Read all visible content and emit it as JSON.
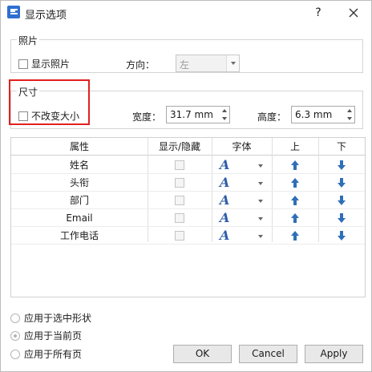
{
  "window": {
    "title": "显示选项",
    "help": "?"
  },
  "photo_group": {
    "label": "照片",
    "show_photo_label": "显示照片",
    "direction_label": "方向：",
    "direction_value": "左"
  },
  "size_group": {
    "label": "尺寸",
    "keep_size_label": "不改变大小",
    "width_label": "宽度：",
    "width_value": "31.7 mm",
    "height_label": "高度：",
    "height_value": "6.3 mm"
  },
  "table": {
    "headers": [
      "属性",
      "显示/隐藏",
      "字体",
      "上",
      "下"
    ],
    "rows": [
      {
        "property": "姓名"
      },
      {
        "property": "头衔"
      },
      {
        "property": "部门"
      },
      {
        "property": "Email"
      },
      {
        "property": "工作电话"
      }
    ],
    "font_glyph": "A",
    "up_icon": "arrow-up-icon",
    "down_icon": "arrow-down-icon",
    "arrow_color": "#2f6fb8"
  },
  "apply_scope": {
    "options": [
      "应用于选中形状",
      "应用于当前页",
      "应用于所有页"
    ],
    "selected_index": 1
  },
  "buttons": {
    "ok": "OK",
    "cancel": "Cancel",
    "apply": "Apply"
  },
  "highlight_color": "#e0201f"
}
